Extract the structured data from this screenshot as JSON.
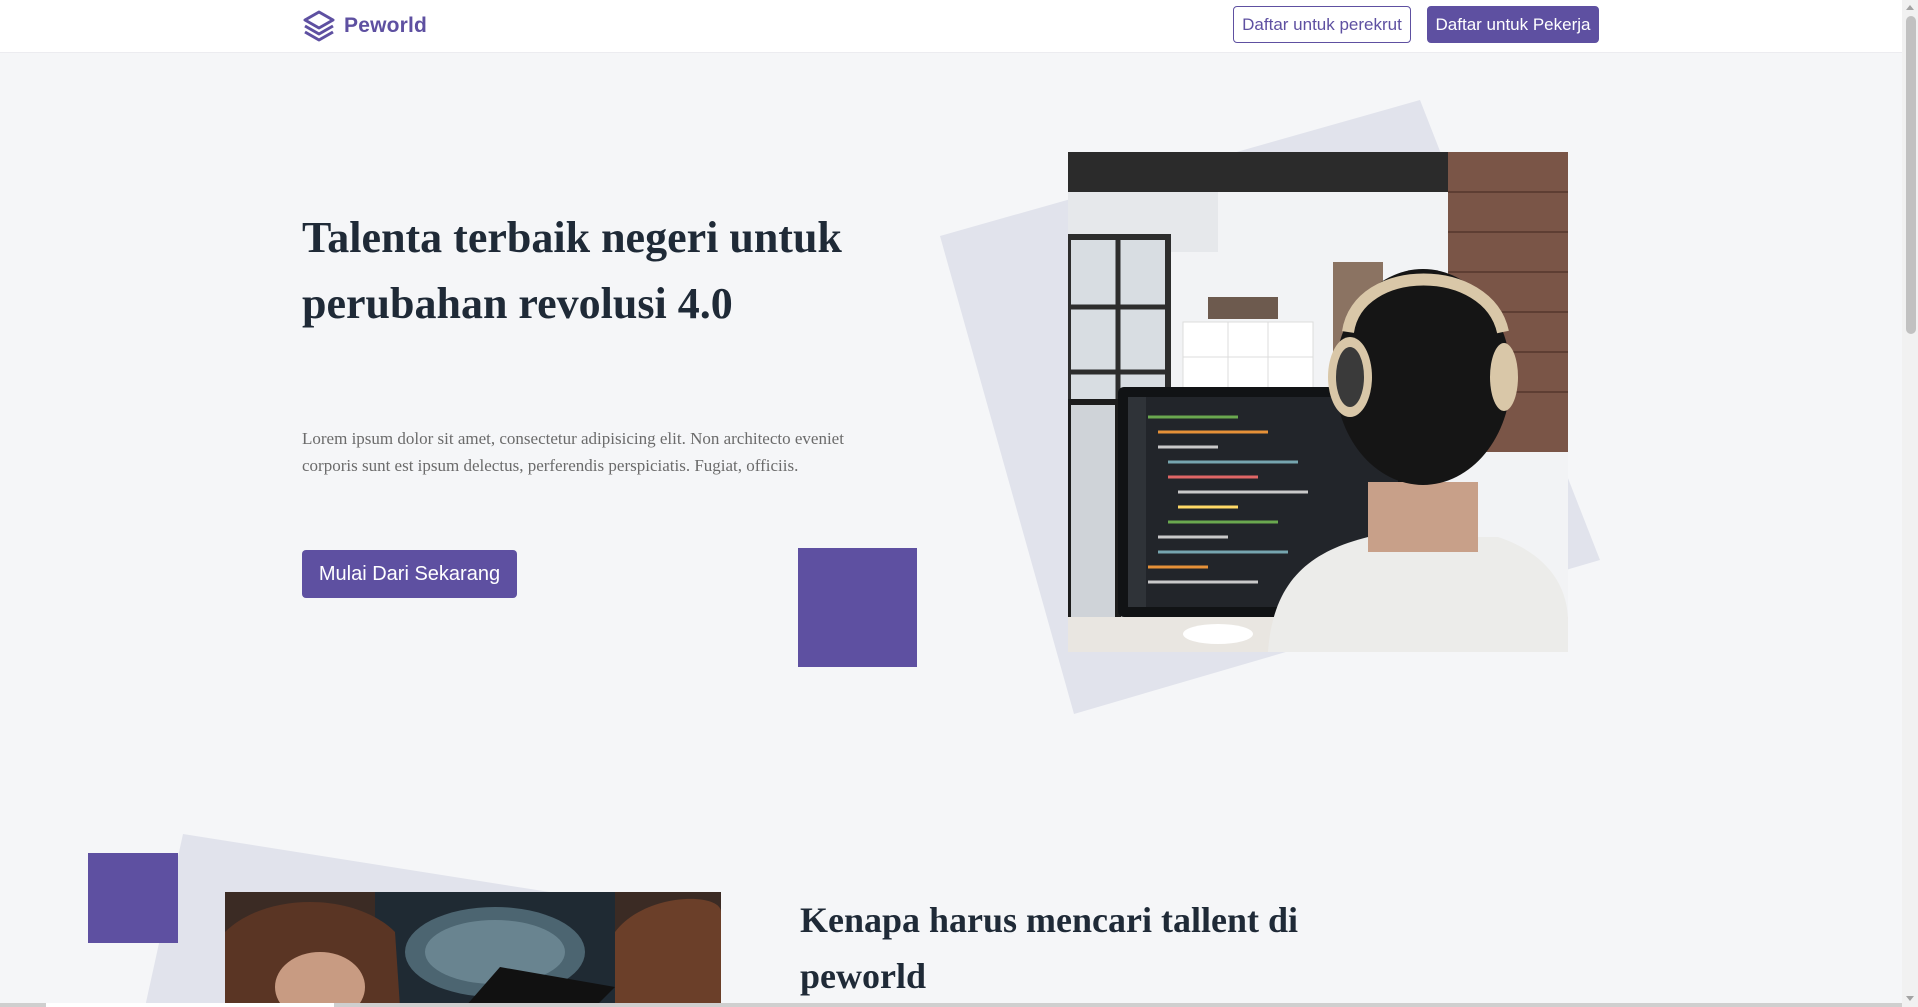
{
  "navbar": {
    "brand_name": "Peworld",
    "btn_recruiter": "Daftar untuk perekrut",
    "btn_worker": "Daftar untuk Pekerja"
  },
  "hero": {
    "title": "Talenta terbaik negeri untuk perubahan revolusi 4.0",
    "description": "Lorem ipsum dolor sit amet, consectetur adipisicing elit. Non architecto eveniet corporis sunt est ipsum delectus, perferendis perspiciatis. Fugiat, officiis.",
    "cta": "Mulai Dari Sekarang"
  },
  "section2": {
    "title": "Kenapa harus mencari tallent di peworld"
  },
  "colors": {
    "accent": "#5e50a1",
    "background": "#f5f6f8",
    "tilted_shape": "#e1e3ec",
    "heading": "#1f2a37"
  },
  "icons": {
    "brand": "layers-icon",
    "scroll_up": "triangle-up-icon",
    "scroll_down": "triangle-down-icon"
  }
}
